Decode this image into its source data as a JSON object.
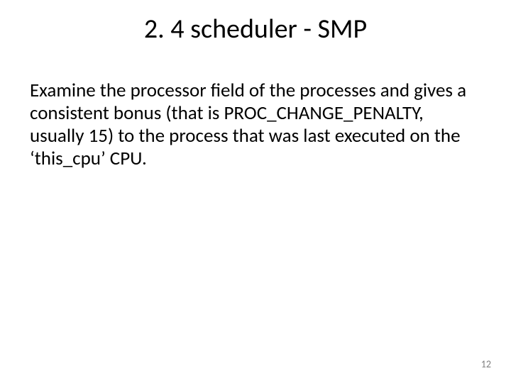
{
  "title": "2. 4 scheduler - SMP",
  "body": "Examine the processor field of the processes and gives a consistent bonus (that is PROC_CHANGE_PENALTY, usually 15) to the process that was last executed on the ‘this_cpu’ CPU.",
  "pageNumber": "12"
}
